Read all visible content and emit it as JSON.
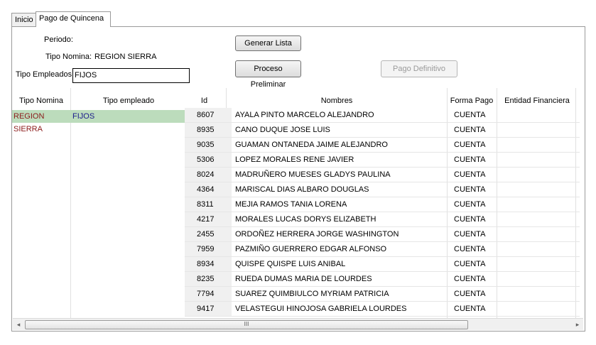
{
  "tabs": [
    {
      "label": "Inicio"
    },
    {
      "label": "Pago de Quincena"
    }
  ],
  "form": {
    "periodo_label": "Periodo:",
    "tipo_nomina_label": "Tipo Nomina:",
    "tipo_nomina_value": "REGION SIERRA",
    "tipo_empleados_label": "Tipo Empleados:",
    "tipo_empleados_value": "FIJOS"
  },
  "buttons": {
    "generar": "Generar Lista",
    "preliminar": "Proceso Preliminar",
    "definitivo": "Pago Definitivo"
  },
  "left_table": {
    "headers": [
      "Tipo Nomina",
      "Tipo empleado"
    ],
    "rows": [
      {
        "tipo_nomina": "REGION SIERRA",
        "tipo_empleado": "FIJOS"
      }
    ]
  },
  "grid": {
    "headers": [
      "Id",
      "Nombres",
      "Forma Pago",
      "Entidad Financiera"
    ],
    "rows": [
      {
        "id": "8607",
        "nombre": "AYALA PINTO MARCELO ALEJANDRO",
        "forma_pago": "CUENTA",
        "entidad": ""
      },
      {
        "id": "8935",
        "nombre": "CANO DUQUE JOSE LUIS",
        "forma_pago": "CUENTA",
        "entidad": ""
      },
      {
        "id": "9035",
        "nombre": "GUAMAN ONTANEDA JAIME ALEJANDRO",
        "forma_pago": "CUENTA",
        "entidad": ""
      },
      {
        "id": "5306",
        "nombre": "LOPEZ MORALES RENE JAVIER",
        "forma_pago": "CUENTA",
        "entidad": ""
      },
      {
        "id": "8024",
        "nombre": "MADRUÑERO MUESES GLADYS PAULINA",
        "forma_pago": "CUENTA",
        "entidad": ""
      },
      {
        "id": "4364",
        "nombre": "MARISCAL DIAS ALBARO DOUGLAS",
        "forma_pago": "CUENTA",
        "entidad": ""
      },
      {
        "id": "8311",
        "nombre": "MEJIA RAMOS TANIA LORENA",
        "forma_pago": "CUENTA",
        "entidad": ""
      },
      {
        "id": "4217",
        "nombre": "MORALES LUCAS DORYS ELIZABETH",
        "forma_pago": "CUENTA",
        "entidad": ""
      },
      {
        "id": "2455",
        "nombre": "ORDOÑEZ HERRERA JORGE WASHINGTON",
        "forma_pago": "CUENTA",
        "entidad": ""
      },
      {
        "id": "7959",
        "nombre": "PAZMIÑO GUERRERO EDGAR ALFONSO",
        "forma_pago": "CUENTA",
        "entidad": ""
      },
      {
        "id": "8934",
        "nombre": "QUISPE QUISPE LUIS ANIBAL",
        "forma_pago": "CUENTA",
        "entidad": ""
      },
      {
        "id": "8235",
        "nombre": "RUEDA DUMAS MARIA DE LOURDES",
        "forma_pago": "CUENTA",
        "entidad": ""
      },
      {
        "id": "7794",
        "nombre": "SUAREZ QUIMBIULCO MYRIAM PATRICIA",
        "forma_pago": "CUENTA",
        "entidad": ""
      },
      {
        "id": "9417",
        "nombre": "VELASTEGUI HINOJOSA GABRIELA LOURDES",
        "forma_pago": "CUENTA",
        "entidad": ""
      }
    ]
  },
  "scrollbar": {
    "left_arrow": "◂",
    "right_arrow": "▸",
    "grip": "III"
  },
  "colors": {
    "selected_row": "#bcdcbc",
    "tipo_nomina_text": "#8b1a1a",
    "tipo_empleado_text": "#1a1a8b"
  }
}
